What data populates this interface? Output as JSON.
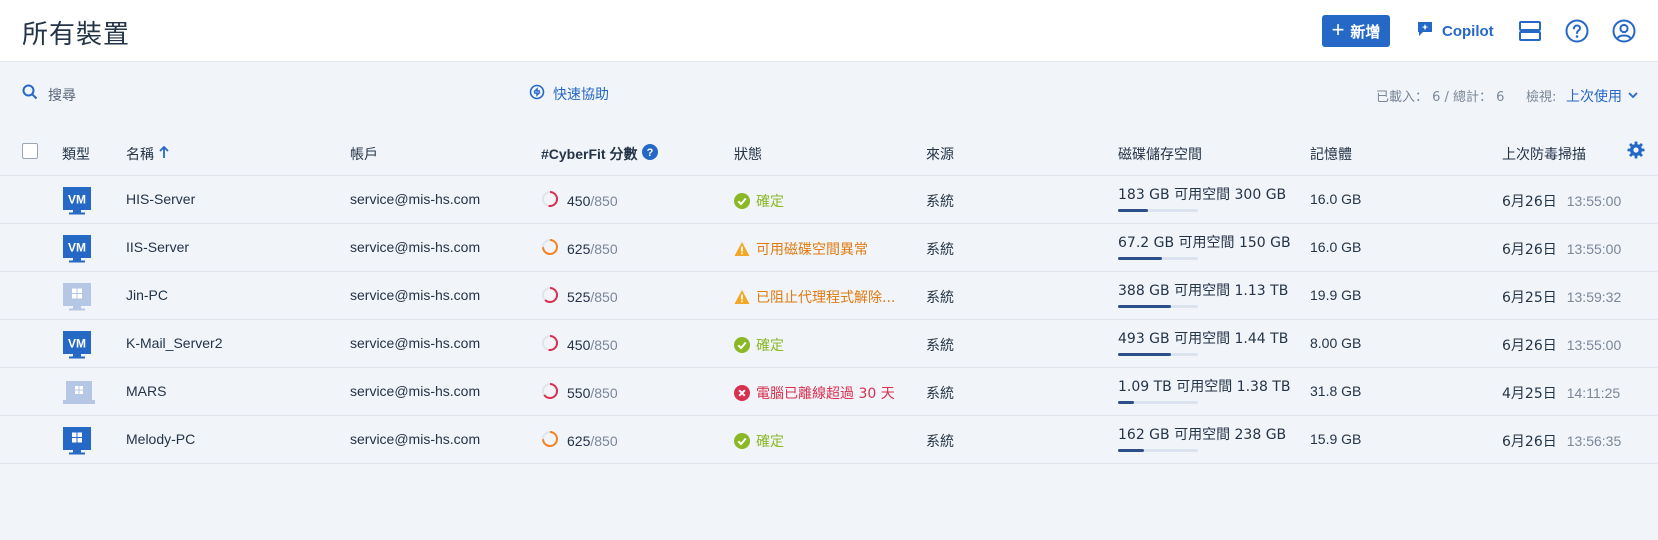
{
  "header": {
    "title": "所有裝置",
    "new_label": "新增",
    "copilot_label": "Copilot"
  },
  "toolbar": {
    "search_placeholder": "搜尋",
    "quick_assist": "快速協助",
    "counts": "已載入： 6 / 總計： 6",
    "view_label": "檢視:",
    "view_value": "上次使用"
  },
  "columns": {
    "type": "類型",
    "name": "名稱",
    "account": "帳戶",
    "cyberfit": "#CyberFit 分數",
    "status": "狀態",
    "source": "來源",
    "disk": "磁碟儲存空間",
    "memory": "記憶體",
    "last_scan": "上次防毒掃描"
  },
  "colors": {
    "accent": "#2668c5",
    "ok": "#8bb826",
    "warn": "#f5a623",
    "error": "#d9304f",
    "disk_fill": "#2c4f8a"
  },
  "rows": [
    {
      "icon": "vm-icon",
      "name": "HIS-Server",
      "account": "service@mis-hs.com",
      "score": "450",
      "score_max": "/850",
      "score_fraction": 0.53,
      "score_color": "#d9304f",
      "status_type": "ok",
      "status": "確定",
      "source": "系統",
      "disk": "183 GB 可用空間 300 GB",
      "disk_used_fraction": 0.38,
      "memory": "16.0 GB",
      "date": "6月26日",
      "time": "13:55:00"
    },
    {
      "icon": "vm-icon",
      "name": "IIS-Server",
      "account": "service@mis-hs.com",
      "score": "625",
      "score_max": "/850",
      "score_fraction": 0.74,
      "score_color": "#f5821f",
      "status_type": "warn",
      "status": "可用磁碟空間異常",
      "source": "系統",
      "disk": "67.2 GB 可用空間 150 GB",
      "disk_used_fraction": 0.55,
      "memory": "16.0 GB",
      "date": "6月26日",
      "time": "13:55:00"
    },
    {
      "icon": "windows-desktop-icon",
      "name": "Jin-PC",
      "account": "service@mis-hs.com",
      "score": "525",
      "score_max": "/850",
      "score_fraction": 0.62,
      "score_color": "#d9304f",
      "status_type": "warn",
      "status": "已阻止代理程式解除...",
      "source": "系統",
      "disk": "388 GB 可用空間 1.13 TB",
      "disk_used_fraction": 0.66,
      "memory": "19.9 GB",
      "date": "6月25日",
      "time": "13:59:32"
    },
    {
      "icon": "vm-icon",
      "name": "K-Mail_Server2",
      "account": "service@mis-hs.com",
      "score": "450",
      "score_max": "/850",
      "score_fraction": 0.53,
      "score_color": "#d9304f",
      "status_type": "ok",
      "status": "確定",
      "source": "系統",
      "disk": "493 GB 可用空間 1.44 TB",
      "disk_used_fraction": 0.66,
      "memory": "8.00 GB",
      "date": "6月26日",
      "time": "13:55:00"
    },
    {
      "icon": "laptop-icon",
      "name": "MARS",
      "account": "service@mis-hs.com",
      "score": "550",
      "score_max": "/850",
      "score_fraction": 0.65,
      "score_color": "#d9304f",
      "status_type": "error",
      "status": "電腦已離線超過 30 天",
      "source": "系統",
      "disk": "1.09 TB 可用空間 1.38 TB",
      "disk_used_fraction": 0.2,
      "memory": "31.8 GB",
      "date": "4月25日",
      "time": "14:11:25"
    },
    {
      "icon": "windows-desktop-icon-online",
      "name": "Melody-PC",
      "account": "service@mis-hs.com",
      "score": "625",
      "score_max": "/850",
      "score_fraction": 0.74,
      "score_color": "#f5821f",
      "status_type": "ok",
      "status": "確定",
      "source": "系統",
      "disk": "162 GB 可用空間 238 GB",
      "disk_used_fraction": 0.32,
      "memory": "15.9 GB",
      "date": "6月26日",
      "time": "13:56:35"
    }
  ]
}
